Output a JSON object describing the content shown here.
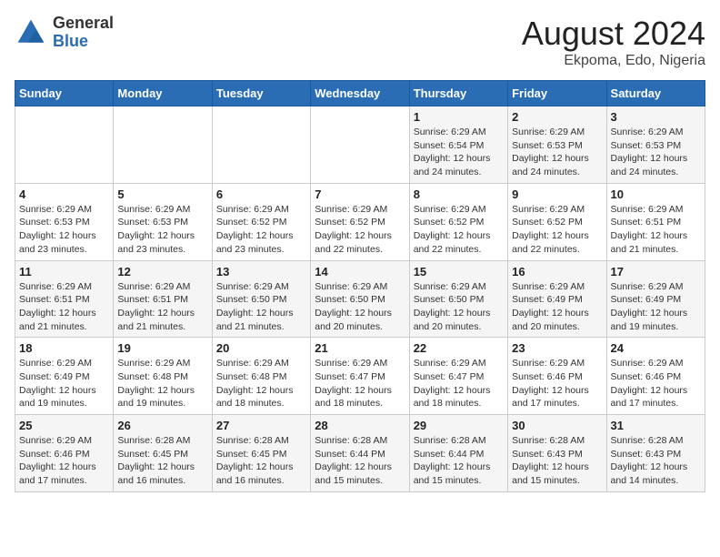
{
  "logo": {
    "general": "General",
    "blue": "Blue"
  },
  "title": "August 2024",
  "location": "Ekpoma, Edo, Nigeria",
  "days_header": [
    "Sunday",
    "Monday",
    "Tuesday",
    "Wednesday",
    "Thursday",
    "Friday",
    "Saturday"
  ],
  "weeks": [
    [
      {
        "day": "",
        "info": ""
      },
      {
        "day": "",
        "info": ""
      },
      {
        "day": "",
        "info": ""
      },
      {
        "day": "",
        "info": ""
      },
      {
        "day": "1",
        "info": "Sunrise: 6:29 AM\nSunset: 6:54 PM\nDaylight: 12 hours and 24 minutes."
      },
      {
        "day": "2",
        "info": "Sunrise: 6:29 AM\nSunset: 6:53 PM\nDaylight: 12 hours and 24 minutes."
      },
      {
        "day": "3",
        "info": "Sunrise: 6:29 AM\nSunset: 6:53 PM\nDaylight: 12 hours and 24 minutes."
      }
    ],
    [
      {
        "day": "4",
        "info": "Sunrise: 6:29 AM\nSunset: 6:53 PM\nDaylight: 12 hours and 23 minutes."
      },
      {
        "day": "5",
        "info": "Sunrise: 6:29 AM\nSunset: 6:53 PM\nDaylight: 12 hours and 23 minutes."
      },
      {
        "day": "6",
        "info": "Sunrise: 6:29 AM\nSunset: 6:52 PM\nDaylight: 12 hours and 23 minutes."
      },
      {
        "day": "7",
        "info": "Sunrise: 6:29 AM\nSunset: 6:52 PM\nDaylight: 12 hours and 22 minutes."
      },
      {
        "day": "8",
        "info": "Sunrise: 6:29 AM\nSunset: 6:52 PM\nDaylight: 12 hours and 22 minutes."
      },
      {
        "day": "9",
        "info": "Sunrise: 6:29 AM\nSunset: 6:52 PM\nDaylight: 12 hours and 22 minutes."
      },
      {
        "day": "10",
        "info": "Sunrise: 6:29 AM\nSunset: 6:51 PM\nDaylight: 12 hours and 21 minutes."
      }
    ],
    [
      {
        "day": "11",
        "info": "Sunrise: 6:29 AM\nSunset: 6:51 PM\nDaylight: 12 hours and 21 minutes."
      },
      {
        "day": "12",
        "info": "Sunrise: 6:29 AM\nSunset: 6:51 PM\nDaylight: 12 hours and 21 minutes."
      },
      {
        "day": "13",
        "info": "Sunrise: 6:29 AM\nSunset: 6:50 PM\nDaylight: 12 hours and 21 minutes."
      },
      {
        "day": "14",
        "info": "Sunrise: 6:29 AM\nSunset: 6:50 PM\nDaylight: 12 hours and 20 minutes."
      },
      {
        "day": "15",
        "info": "Sunrise: 6:29 AM\nSunset: 6:50 PM\nDaylight: 12 hours and 20 minutes."
      },
      {
        "day": "16",
        "info": "Sunrise: 6:29 AM\nSunset: 6:49 PM\nDaylight: 12 hours and 20 minutes."
      },
      {
        "day": "17",
        "info": "Sunrise: 6:29 AM\nSunset: 6:49 PM\nDaylight: 12 hours and 19 minutes."
      }
    ],
    [
      {
        "day": "18",
        "info": "Sunrise: 6:29 AM\nSunset: 6:49 PM\nDaylight: 12 hours and 19 minutes."
      },
      {
        "day": "19",
        "info": "Sunrise: 6:29 AM\nSunset: 6:48 PM\nDaylight: 12 hours and 19 minutes."
      },
      {
        "day": "20",
        "info": "Sunrise: 6:29 AM\nSunset: 6:48 PM\nDaylight: 12 hours and 18 minutes."
      },
      {
        "day": "21",
        "info": "Sunrise: 6:29 AM\nSunset: 6:47 PM\nDaylight: 12 hours and 18 minutes."
      },
      {
        "day": "22",
        "info": "Sunrise: 6:29 AM\nSunset: 6:47 PM\nDaylight: 12 hours and 18 minutes."
      },
      {
        "day": "23",
        "info": "Sunrise: 6:29 AM\nSunset: 6:46 PM\nDaylight: 12 hours and 17 minutes."
      },
      {
        "day": "24",
        "info": "Sunrise: 6:29 AM\nSunset: 6:46 PM\nDaylight: 12 hours and 17 minutes."
      }
    ],
    [
      {
        "day": "25",
        "info": "Sunrise: 6:29 AM\nSunset: 6:46 PM\nDaylight: 12 hours and 17 minutes."
      },
      {
        "day": "26",
        "info": "Sunrise: 6:28 AM\nSunset: 6:45 PM\nDaylight: 12 hours and 16 minutes."
      },
      {
        "day": "27",
        "info": "Sunrise: 6:28 AM\nSunset: 6:45 PM\nDaylight: 12 hours and 16 minutes."
      },
      {
        "day": "28",
        "info": "Sunrise: 6:28 AM\nSunset: 6:44 PM\nDaylight: 12 hours and 15 minutes."
      },
      {
        "day": "29",
        "info": "Sunrise: 6:28 AM\nSunset: 6:44 PM\nDaylight: 12 hours and 15 minutes."
      },
      {
        "day": "30",
        "info": "Sunrise: 6:28 AM\nSunset: 6:43 PM\nDaylight: 12 hours and 15 minutes."
      },
      {
        "day": "31",
        "info": "Sunrise: 6:28 AM\nSunset: 6:43 PM\nDaylight: 12 hours and 14 minutes."
      }
    ]
  ]
}
